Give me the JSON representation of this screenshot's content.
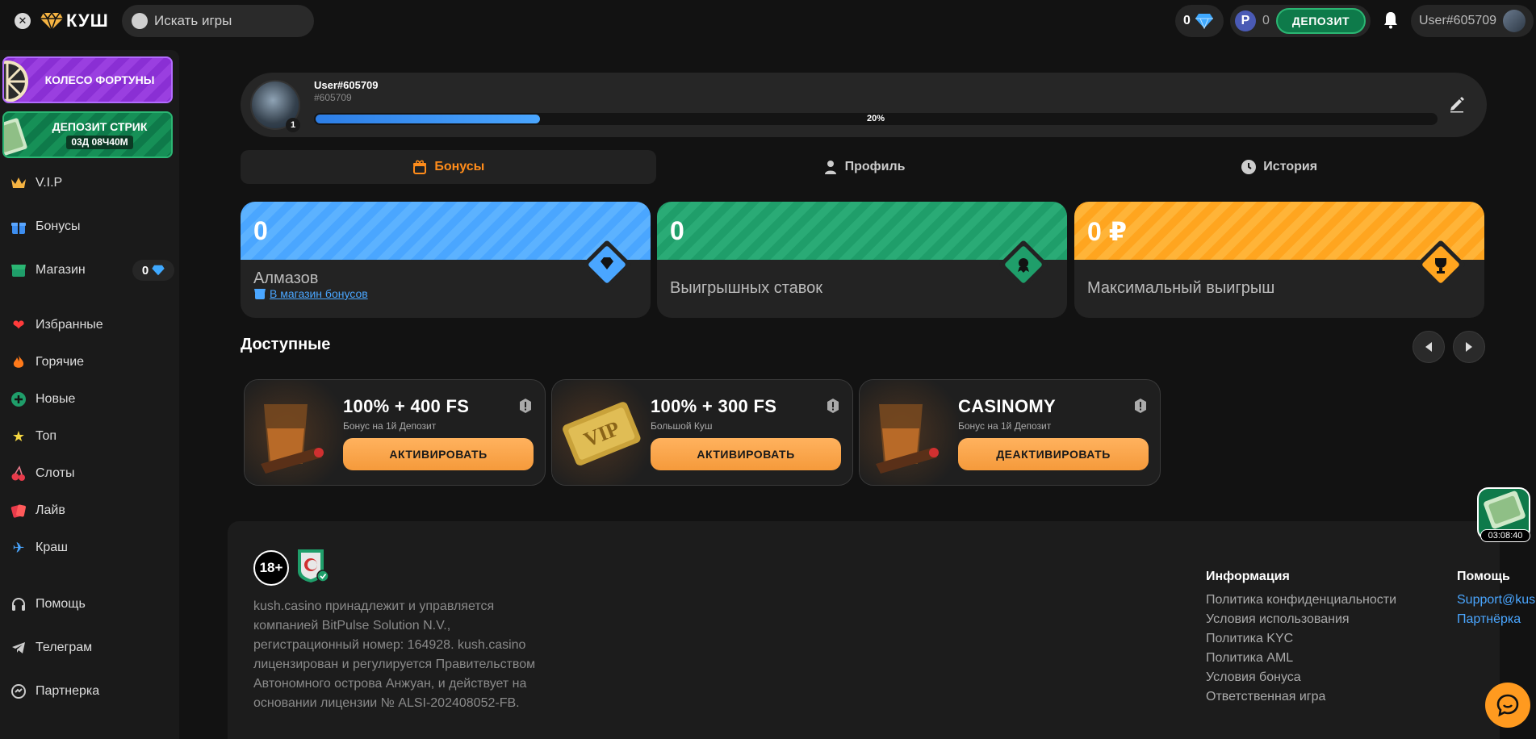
{
  "header": {
    "logo_text": "КУШ",
    "search_placeholder": "Искать игры",
    "gems_count": "0",
    "wallet_currency_symbol": "P",
    "wallet_amount": "0",
    "deposit_label": "ДЕПОЗИТ",
    "username": "User#605709"
  },
  "sidebar": {
    "promo_wheel": "КОЛЕСО ФОРТУНЫ",
    "promo_streak": "ДЕПОЗИТ СТРИК",
    "promo_streak_timer": "03Д 08Ч40М",
    "items": [
      {
        "label": "V.I.P",
        "icon": "crown-icon"
      },
      {
        "label": "Бонусы",
        "icon": "gift-icon"
      },
      {
        "label": "Магазин",
        "icon": "shop-icon",
        "badge": "0"
      },
      {
        "label": "Избранные",
        "icon": "heart-icon"
      },
      {
        "label": "Горячие",
        "icon": "fire-icon"
      },
      {
        "label": "Новые",
        "icon": "plus-icon"
      },
      {
        "label": "Топ",
        "icon": "star-icon"
      },
      {
        "label": "Слоты",
        "icon": "cherry-icon"
      },
      {
        "label": "Лайв",
        "icon": "cards-icon"
      },
      {
        "label": "Краш",
        "icon": "plane-icon"
      },
      {
        "label": "Помощь",
        "icon": "headphones-icon"
      },
      {
        "label": "Телеграм",
        "icon": "telegram-icon"
      },
      {
        "label": "Партнерка",
        "icon": "partner-icon"
      }
    ]
  },
  "profile": {
    "name": "User#605709",
    "id": "#605709",
    "level": "1",
    "progress_percent": 20,
    "progress_label": "20%"
  },
  "tabs": [
    {
      "label": "Бонусы",
      "active": true
    },
    {
      "label": "Профиль",
      "active": false
    },
    {
      "label": "История",
      "active": false
    }
  ],
  "stats": [
    {
      "value": "0",
      "label": "Алмазов",
      "link": "В магазин бонусов",
      "color": "#4aa6ff"
    },
    {
      "value": "0",
      "label": "Выигрышных ставок",
      "color": "#1f9e6a"
    },
    {
      "value": "0 ₽",
      "label": "Максимальный выигрыш",
      "color": "#ffa51f"
    }
  ],
  "available": {
    "title": "Доступные",
    "bonuses": [
      {
        "title": "100% + 400 FS",
        "subtitle": "Бонус на 1й Депозит",
        "button": "АКТИВИРОВАТЬ"
      },
      {
        "title": "100% + 300 FS",
        "subtitle": "Большой Куш",
        "button": "АКТИВИРОВАТЬ"
      },
      {
        "title": "CASINOMY",
        "subtitle": "Бонус на 1й Депозит",
        "button": "ДЕАКТИВИРОВАТЬ"
      }
    ]
  },
  "footer": {
    "age": "18+",
    "about": "kush.casino принадлежит и управляется компанией BitPulse Solution N.V., регистрационный номер: 164928. kush.casino лицензирован и регулируется Правительством Автономного острова Анжуан, и действует на основании лицензии № ALSI-202408052-FB.",
    "info_title": "Информация",
    "info_links": [
      "Политика конфиденциальности",
      "Условия использования",
      "Политика KYC",
      "Политика AML",
      "Условия бонуса",
      "Ответственная игра"
    ],
    "help_title": "Помощь",
    "help_links": [
      "Support@kush.casino",
      "Партнёрка"
    ]
  },
  "floating": {
    "streak_timer": "03:08:40"
  },
  "colors": {
    "accent": "#ff8c1a",
    "deposit": "#0e7a4a",
    "link": "#4aa6ff"
  }
}
